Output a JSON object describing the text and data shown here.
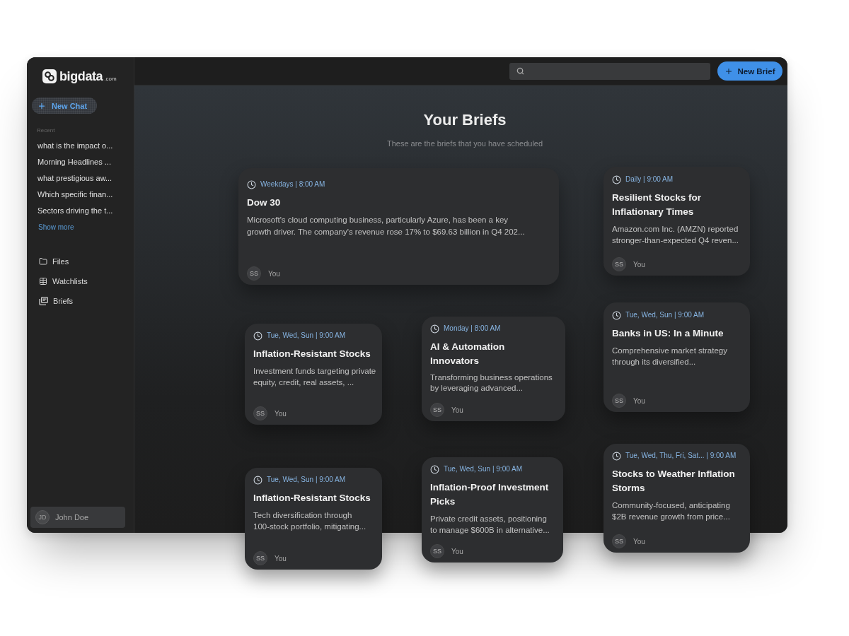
{
  "sidebar": {
    "logo": {
      "name": "bigdata",
      "domain": ".com"
    },
    "new_chat": "New Chat",
    "recent_label": "Recent",
    "recent": [
      "what is the impact o...",
      "Morning Headlines ...",
      "what prestigious aw...",
      "Which specific finan...",
      "Sectors driving the t..."
    ],
    "show_more": "Show more",
    "nav": [
      {
        "kind": "files",
        "label": "Files"
      },
      {
        "kind": "watchlists",
        "label": "Watchlists"
      },
      {
        "kind": "briefs",
        "label": "Briefs"
      }
    ],
    "user": {
      "initials": "JD",
      "name": "John Doe"
    }
  },
  "topbar": {
    "new_brief": "New Brief"
  },
  "header": {
    "title": "Your Briefs",
    "subtitle": "These are the briefs that you have scheduled"
  },
  "briefs": [
    {
      "schedule": "Weekdays | 8:00 AM",
      "title": "Dow 30",
      "description": "Microsoft's cloud computing business, particularly Azure, has been a key growth driver. The company's revenue rose 17% to $69.63 billion in Q4 202...",
      "owner": {
        "initials": "SS",
        "name": "You"
      }
    },
    {
      "schedule": "Daily | 9:00 AM",
      "title": "Resilient Stocks for Inflationary Times",
      "description": "Amazon.com Inc. (AMZN) reported stronger-than-expected Q4 reven...",
      "owner": {
        "initials": "SS",
        "name": "You"
      }
    },
    {
      "schedule": "Tue, Wed, Sun | 9:00 AM",
      "title": "Inflation-Resistant Stocks",
      "description": "Investment funds targeting private equity, credit, real assets, ...",
      "owner": {
        "initials": "SS",
        "name": "You"
      }
    },
    {
      "schedule": "Monday | 8:00 AM",
      "title": "AI & Automation Innovators",
      "description": "Transforming business operations by leveraging advanced...",
      "owner": {
        "initials": "SS",
        "name": "You"
      }
    },
    {
      "schedule": "Tue, Wed, Sun | 9:00 AM",
      "title": "Banks in US: In a Minute",
      "description": "Comprehensive market strategy through its diversified...",
      "owner": {
        "initials": "SS",
        "name": "You"
      }
    },
    {
      "schedule": "Tue, Wed, Sun | 9:00 AM",
      "title": "Inflation-Resistant Stocks",
      "description": "Tech diversification through 100-stock portfolio, mitigating...",
      "owner": {
        "initials": "SS",
        "name": "You"
      }
    },
    {
      "schedule": "Tue, Wed, Sun | 9:00 AM",
      "title": "Inflation-Proof Investment Picks",
      "description": "Private credit assets, positioning to manage $600B in alternative...",
      "owner": {
        "initials": "SS",
        "name": "You"
      }
    },
    {
      "schedule": "Tue, Wed, Thu, Fri, Sat... | 9:00 AM",
      "title": "Stocks to Weather Inflation Storms",
      "description": "Community-focused, anticipating $2B revenue growth from price...",
      "owner": {
        "initials": "SS",
        "name": "You"
      }
    }
  ]
}
